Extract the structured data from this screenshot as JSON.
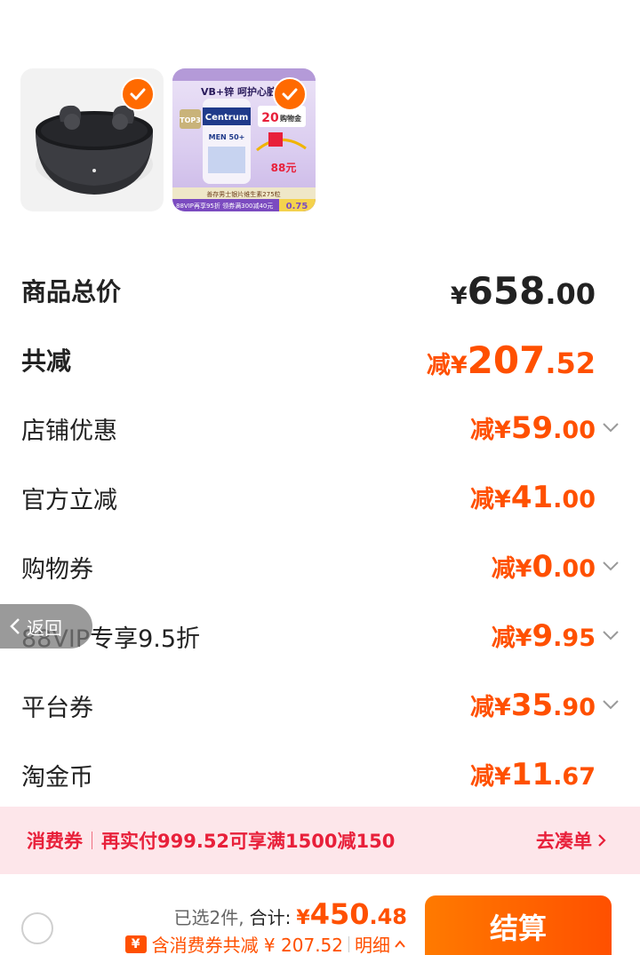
{
  "products": [
    {
      "name": "earbuds",
      "selected": true
    },
    {
      "name": "vitamin",
      "selected": true,
      "headline": "VB+锌 呵护心脏充",
      "brand": "Centrum",
      "tag": "MEN 50+",
      "badge": "TOP3",
      "price_tag": "88元",
      "coupon": "20",
      "coupon_label": "购物金",
      "footer1": "善存男士银片维生素275粒",
      "footer2": "88VIP再享95折 领券满300减40元",
      "footer_price": "0.75"
    }
  ],
  "rows": {
    "total": {
      "label": "商品总价",
      "currency": "¥",
      "int": "658",
      "dec": ".00"
    },
    "reduce_total": {
      "label": "共减",
      "prefix": "减¥",
      "int": "207",
      "dec": ".52"
    },
    "store": {
      "label": "店铺优惠",
      "prefix": "减¥",
      "int": "59",
      "dec": ".00"
    },
    "official": {
      "label": "官方立减",
      "prefix": "减¥",
      "int": "41",
      "dec": ".00"
    },
    "shopping_coupon": {
      "label": "购物券",
      "prefix": "减¥",
      "int": "0",
      "dec": ".00"
    },
    "vip": {
      "label": "88VIP专享9.5折",
      "prefix": "减¥",
      "int": "9",
      "dec": ".95"
    },
    "platform": {
      "label": "平台券",
      "prefix": "减¥",
      "int": "35",
      "dec": ".90"
    },
    "taojin": {
      "label": "淘金币",
      "prefix": "减¥",
      "int": "11",
      "dec": ".67"
    }
  },
  "back_label": "返回",
  "banner": {
    "tag": "消费券",
    "text": "再实付999.52可享满1500减150",
    "action": "去凑单"
  },
  "footer": {
    "selected": "已选2件,",
    "total_label": "合计:",
    "currency": "¥",
    "total_int": "450",
    "total_dec": ".48",
    "coupon_icon": "¥",
    "discount_text": "含消费券共减 ¥ 207.52",
    "detail_label": "明细",
    "checkout_label": "结算"
  },
  "colors": {
    "accent": "#ff5000",
    "banner_bg": "#fde6ea",
    "banner_text": "#e8203a"
  }
}
